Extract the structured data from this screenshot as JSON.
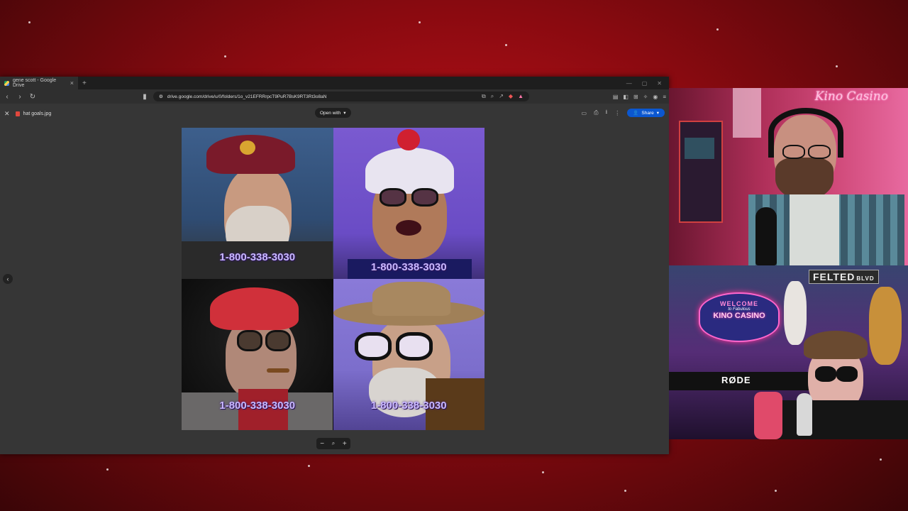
{
  "browser": {
    "tab_title": "gene scott - Google Drive",
    "url": "drive.google.com/drive/u/0/folders/1o_v21EFRRrpcT9PuR7BsK9RT3Rt3o8aN"
  },
  "viewer": {
    "file_name": "hat goals.jpg",
    "open_with_label": "Open with",
    "share_label": "Share",
    "phone_numbers": [
      "1-800-338-3030",
      "1-800-338-3030",
      "1-800-338-3030",
      "1-800-338-3030"
    ]
  },
  "overlay": {
    "cam1_logo": "Kino Casino",
    "street_sign": "FELTED",
    "street_sign_suffix": "BLVD",
    "sign_welcome": "WELCOME",
    "sign_fabulous": "to Fabulous",
    "sign_casino": "KINO CASINO",
    "mic_brand": "RØDE"
  },
  "colors": {
    "accent_share": "#0b57d0",
    "background_red": "#c0121a",
    "neon_pink": "#ff3399"
  }
}
